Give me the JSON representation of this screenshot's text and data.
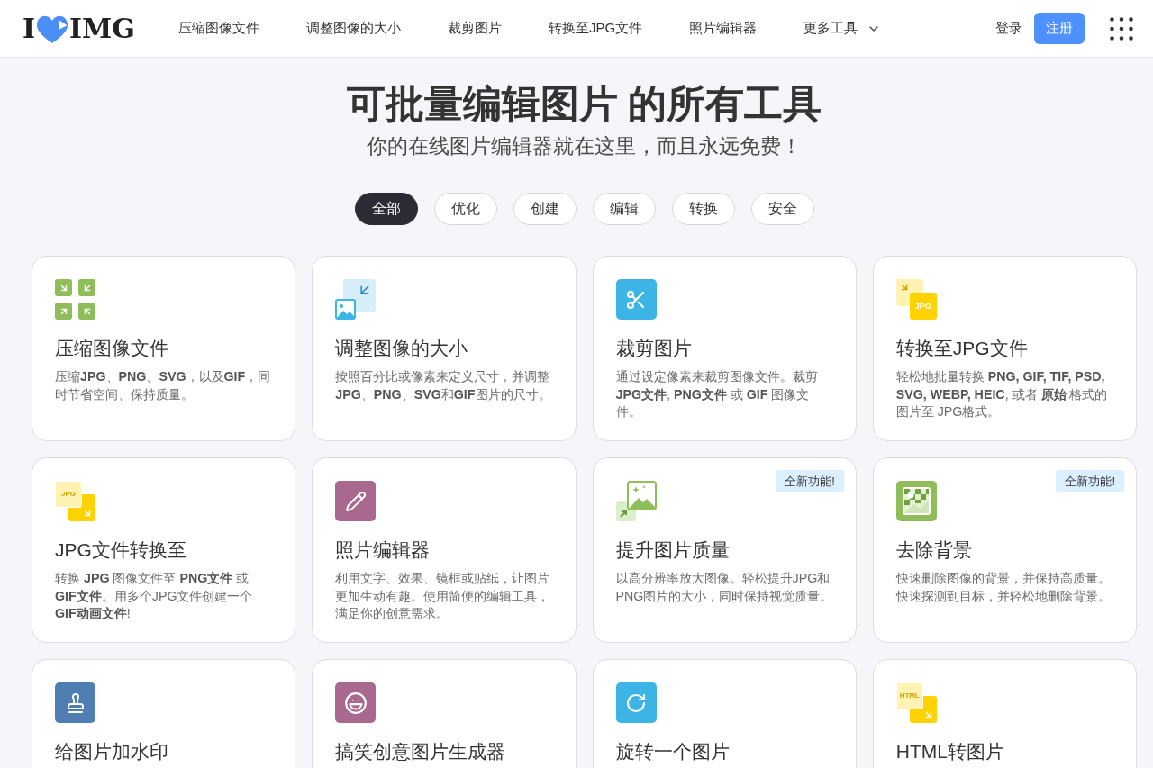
{
  "header": {
    "logo": {
      "left": "I",
      "right": "IMG"
    },
    "nav": [
      {
        "kind": "link",
        "label": "压缩图像文件"
      },
      {
        "kind": "link",
        "label": "调整图像的大小"
      },
      {
        "kind": "link",
        "label": "裁剪图片"
      },
      {
        "kind": "link",
        "label": "转换至JPG文件"
      },
      {
        "kind": "link",
        "label": "照片编辑器"
      },
      {
        "kind": "dropdown",
        "label": "更多工具"
      }
    ],
    "login": "登录",
    "signup": "注册"
  },
  "hero": {
    "title": "可批量编辑图片 的所有工具",
    "subtitle": "你的在线图片编辑器就在这里，而且永远免费！"
  },
  "filters": [
    {
      "label": "全部",
      "selected": true
    },
    {
      "label": "优化",
      "selected": false
    },
    {
      "label": "创建",
      "selected": false
    },
    {
      "label": "编辑",
      "selected": false
    },
    {
      "label": "转换",
      "selected": false
    },
    {
      "label": "安全",
      "selected": false
    }
  ],
  "tools": [
    {
      "kind": "compress",
      "title": "压缩图像文件",
      "description": "压缩**JPG**、**PNG**、**SVG**，以及**GIF**，同时节省空间、保持质量。"
    },
    {
      "kind": "resize",
      "title": "调整图像的大小",
      "description": "按照百分比或像素来定义尺寸，并调整**JPG**、**PNG**、**SVG**和**GIF**图片的尺寸。"
    },
    {
      "kind": "crop",
      "title": "裁剪图片",
      "description": "通过设定像素来裁剪图像文件。裁剪 **JPG文件**, **PNG文件** 或 **GIF** 图像文件。"
    },
    {
      "kind": "to_file",
      "icon_text": "JPG",
      "title": "转换至JPG文件",
      "description": "轻松地批量转换 **PNG, GIF, TIF, PSD, SVG, WEBP, HEIC**, 或者 **原始** 格式的图片至 JPG格式。"
    },
    {
      "kind": "from_file",
      "icon_text": "JPG",
      "title": "JPG文件转换至",
      "description": "转换 **JPG** 图像文件至 **PNG文件** 或 **GIF文件**。用多个JPG文件创建一个**GIF动画文件**!"
    },
    {
      "kind": "editor",
      "title": "照片编辑器",
      "description": "利用文字、效果、镜框或贴纸，让图片更加生动有趣。使用简便的编辑工具，满足你的创意需求。"
    },
    {
      "kind": "upscale",
      "title": "提升图片质量",
      "description": "以高分辨率放大图像。轻松提升JPG和PNG图片的大小，同时保持视觉质量。",
      "badge": "全新功能!"
    },
    {
      "kind": "remove_bg",
      "title": "去除背景",
      "description": "快速删除图像的背景，并保持高质量。快速探测到目标，并轻松地删除背景。",
      "badge": "全新功能!"
    },
    {
      "kind": "watermark",
      "title": "给图片加水印"
    },
    {
      "kind": "meme",
      "title": "搞笑创意图片生成器"
    },
    {
      "kind": "rotate",
      "title": "旋转一个图片"
    },
    {
      "kind": "from_file",
      "icon_text": "HTML",
      "title": "HTML转图片"
    }
  ]
}
